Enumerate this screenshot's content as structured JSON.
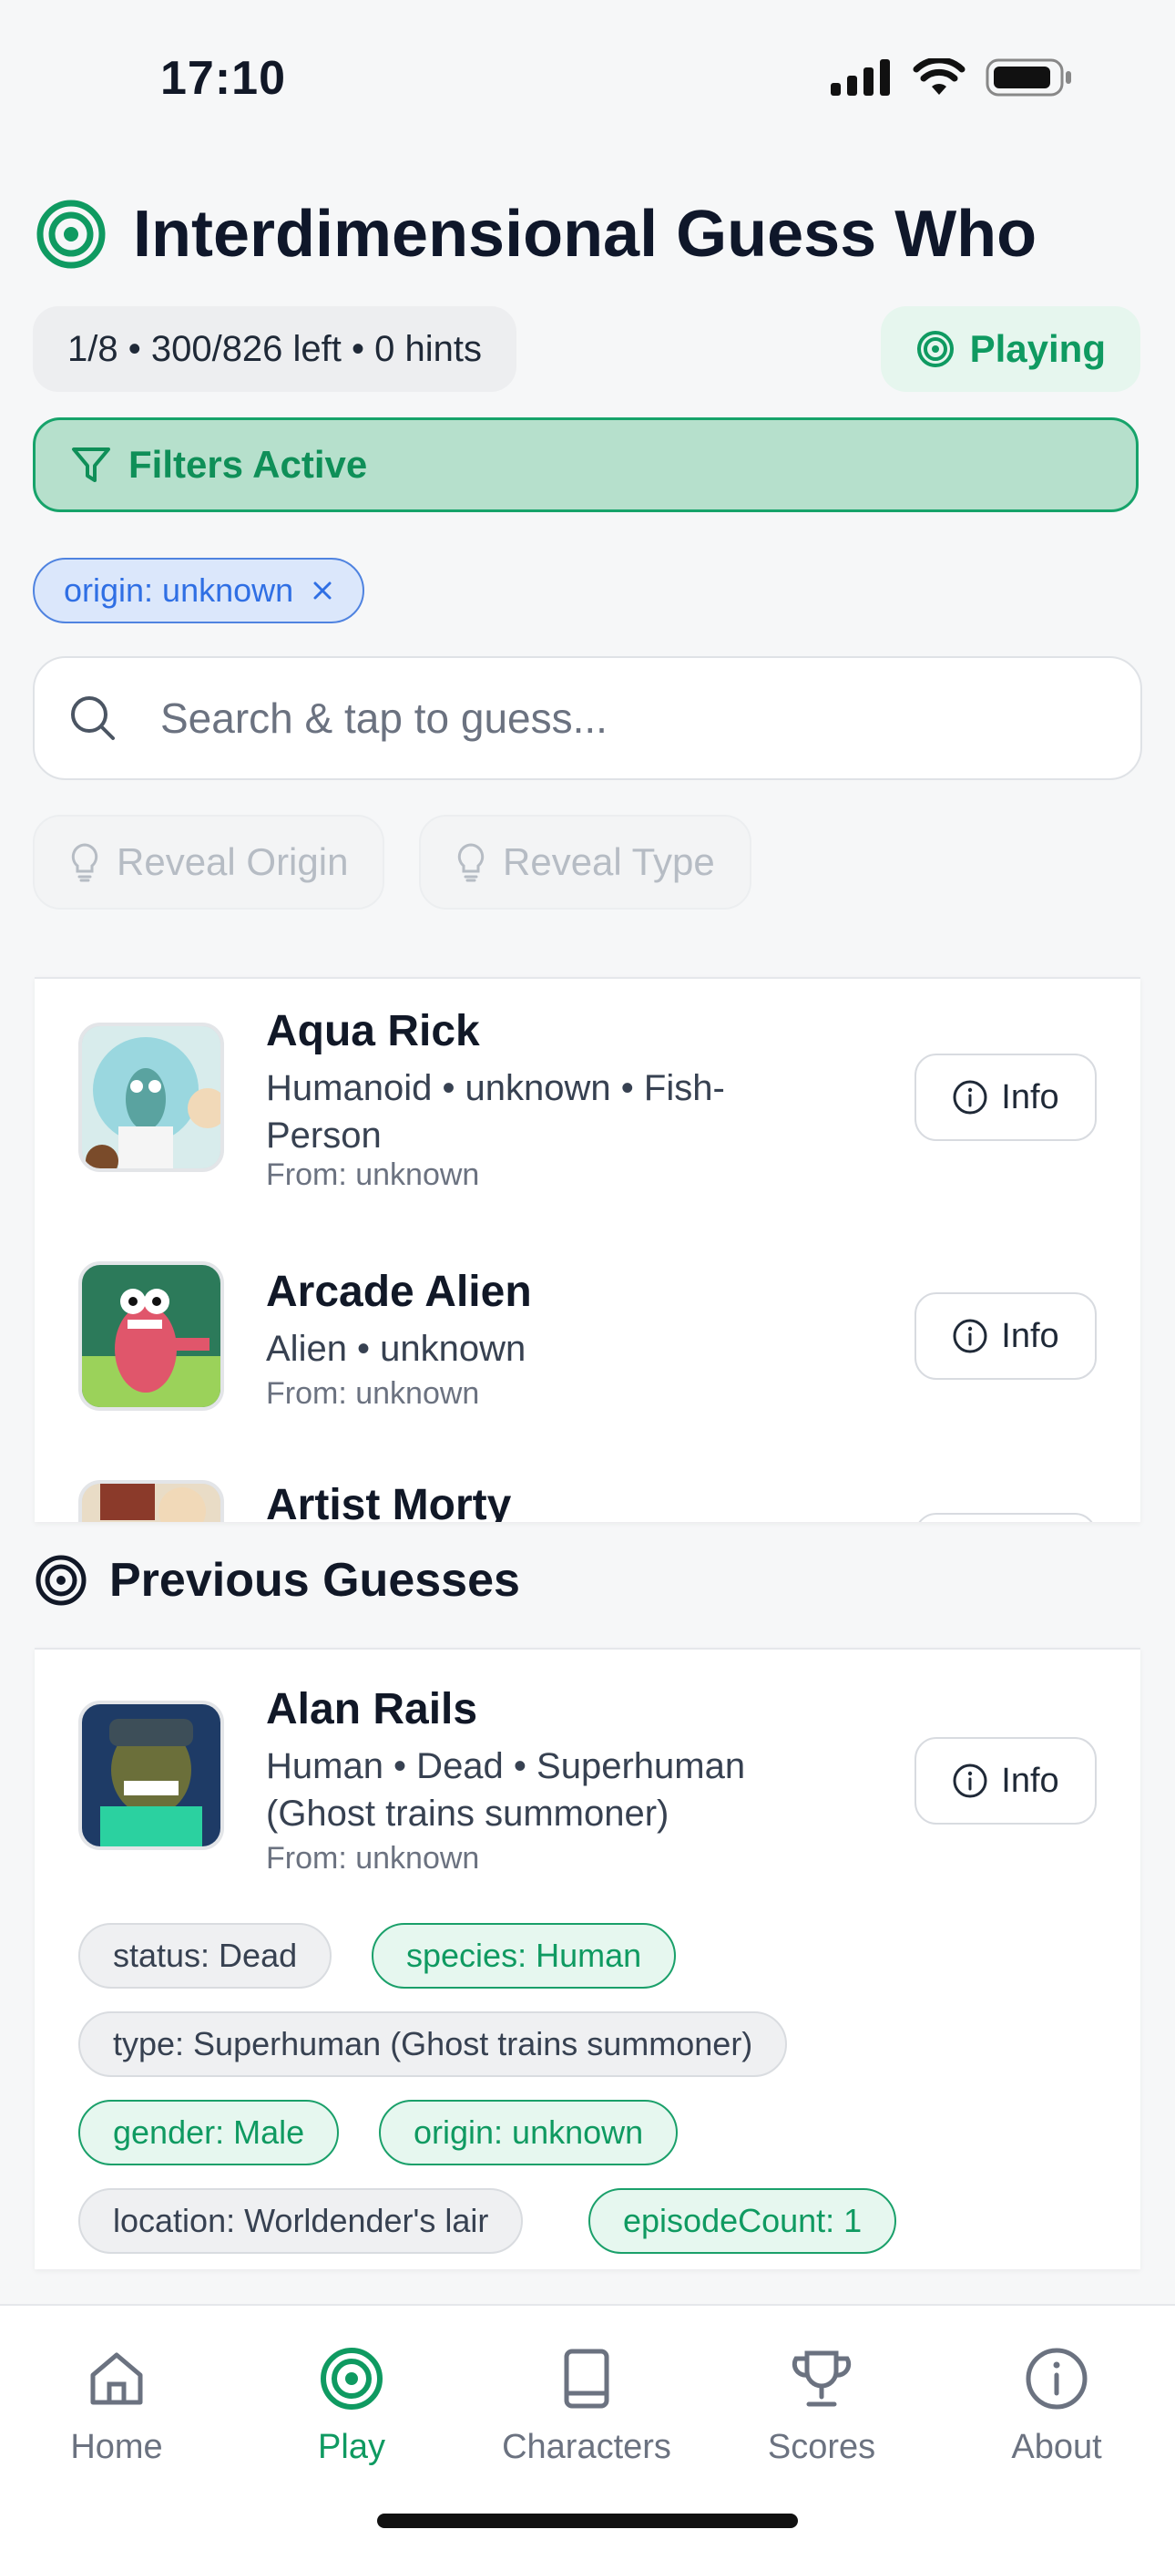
{
  "status_bar": {
    "time": "17:10"
  },
  "header": {
    "title": "Interdimensional Guess Who"
  },
  "stats": {
    "text": "1/8 • 300/826 left • 0 hints",
    "state_label": "Playing"
  },
  "filters": {
    "label": "Filters Active",
    "chips": [
      {
        "label": "origin: unknown"
      }
    ]
  },
  "search": {
    "placeholder": "Search & tap to guess..."
  },
  "hints": {
    "reveal_origin": "Reveal Origin",
    "reveal_type": "Reveal Type"
  },
  "results": [
    {
      "name": "Aqua Rick",
      "sub_line1": "Humanoid • unknown • Fish-",
      "sub_line2": "Person",
      "from": "From: unknown",
      "info_label": "Info"
    },
    {
      "name": "Arcade Alien",
      "sub_line1": "Alien • unknown",
      "sub_line2": "",
      "from": "From: unknown",
      "info_label": "Info"
    },
    {
      "name": "Artist Morty",
      "sub_line1": "",
      "sub_line2": "",
      "from": "",
      "info_label": ""
    }
  ],
  "previous": {
    "title": "Previous Guesses",
    "items": [
      {
        "name": "Alan Rails",
        "sub_line1": "Human • Dead • Superhuman",
        "sub_line2": "(Ghost trains summoner)",
        "from": "From: unknown",
        "info_label": "Info",
        "tags": [
          {
            "label": "status: Dead",
            "match": false
          },
          {
            "label": "species: Human",
            "match": true
          },
          {
            "label": "type: Superhuman (Ghost trains summoner)",
            "match": false
          },
          {
            "label": "gender: Male",
            "match": true
          },
          {
            "label": "origin: unknown",
            "match": true
          },
          {
            "label": "location: Worldender's lair",
            "match": false
          },
          {
            "label": "episodeCount: 1",
            "match": true
          }
        ]
      }
    ]
  },
  "nav": {
    "items": [
      {
        "label": "Home",
        "icon": "home-icon"
      },
      {
        "label": "Play",
        "icon": "target-icon",
        "active": true
      },
      {
        "label": "Characters",
        "icon": "book-icon"
      },
      {
        "label": "Scores",
        "icon": "trophy-icon"
      },
      {
        "label": "About",
        "icon": "info-icon"
      }
    ]
  },
  "colors": {
    "accent": "#0f9a61",
    "filter_bg": "#b6e0cc",
    "chip_blue": "#2f6fe4"
  }
}
